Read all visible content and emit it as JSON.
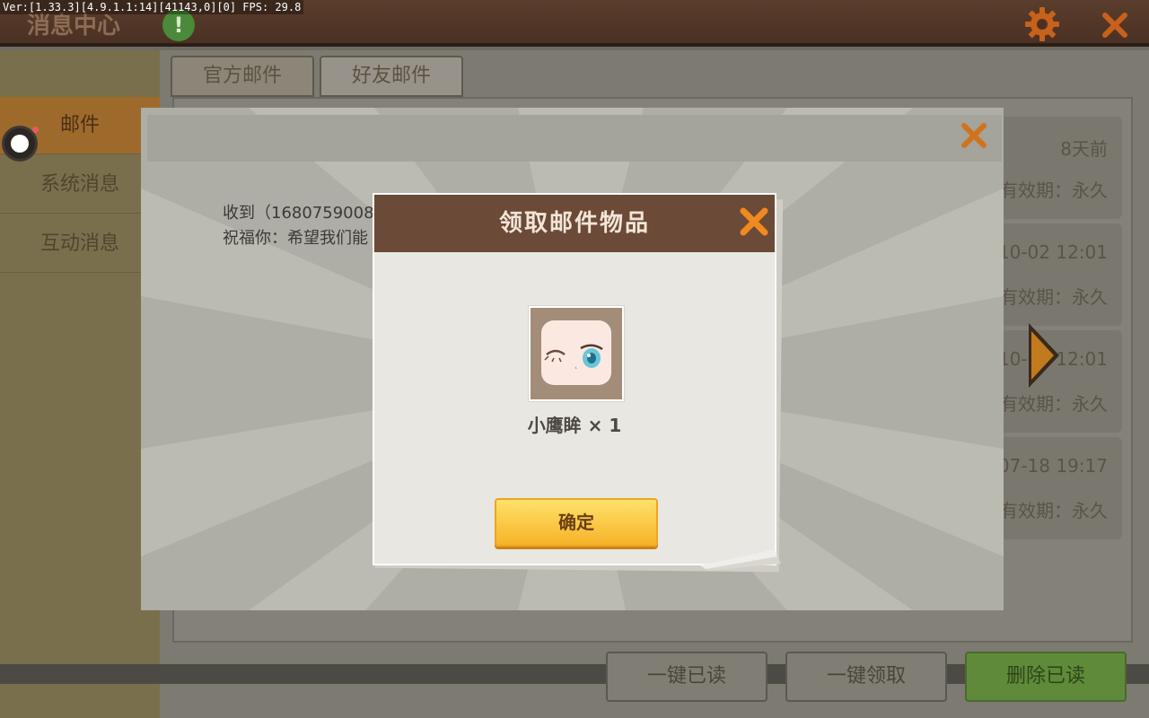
{
  "debug": {
    "text": "Ver:[1.33.3][4.9.1.1:14][41143,0][0] FPS: 29.8"
  },
  "header": {
    "title": "消息中心",
    "alert_symbol": "!"
  },
  "sidebar": {
    "items": [
      {
        "label": "邮件",
        "active": true
      },
      {
        "label": "系统消息",
        "active": false
      },
      {
        "label": "互动消息",
        "active": false
      }
    ]
  },
  "tabs": [
    {
      "label": "官方邮件",
      "active": false
    },
    {
      "label": "好友邮件",
      "active": true
    }
  ],
  "mail_cards": [
    {
      "time": "8天前",
      "expiry": "有效期：永久"
    },
    {
      "time": "10-02 12:01",
      "expiry": "有效期：永久"
    },
    {
      "time": "10-02 12:01",
      "expiry": "有效期：永久"
    },
    {
      "time": "-07-18 19:17",
      "expiry": "有效期：永久"
    }
  ],
  "bottom_buttons": {
    "read_all": "一键已读",
    "claim_all": "一键领取",
    "delete_read": "删除已读"
  },
  "detail": {
    "line1": "收到（1680759008",
    "line2": "祝福你：希望我们能"
  },
  "reward_dialog": {
    "title": "领取邮件物品",
    "item_name": "小鹰眸 × 1",
    "confirm": "确定"
  },
  "colors": {
    "accent_orange": "#f08a1e",
    "header_brown": "#6b4a38",
    "button_yellow": "#f5b428"
  }
}
